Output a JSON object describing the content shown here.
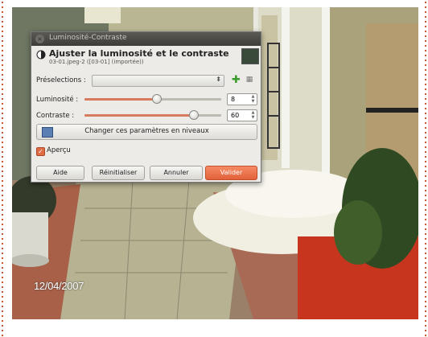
{
  "photo": {
    "date_stamp": "12/04/2007"
  },
  "dialog": {
    "window_title": "Luminosité-Contraste",
    "heading": "Ajuster la luminosité et le contraste",
    "subheading": "03-01.jpeg-2 ([03-01] (importée))",
    "presets": {
      "label": "Préselections :",
      "value": ""
    },
    "brightness": {
      "label": "Luminosité :",
      "value": "8",
      "fraction": 0.53
    },
    "contrast": {
      "label": "Contraste :",
      "value": "60",
      "fraction": 0.8
    },
    "levels_button": "Changer ces paramètres en niveaux",
    "preview": {
      "label": "Aperçu",
      "checked": true
    },
    "buttons": {
      "help": "Aide",
      "reset": "Réinitialiser",
      "cancel": "Annuler",
      "ok": "Valider"
    }
  },
  "colors": {
    "accent": "#e2623a",
    "slider_fill": "#d87a5e",
    "titlebar": "#3d3c38"
  }
}
